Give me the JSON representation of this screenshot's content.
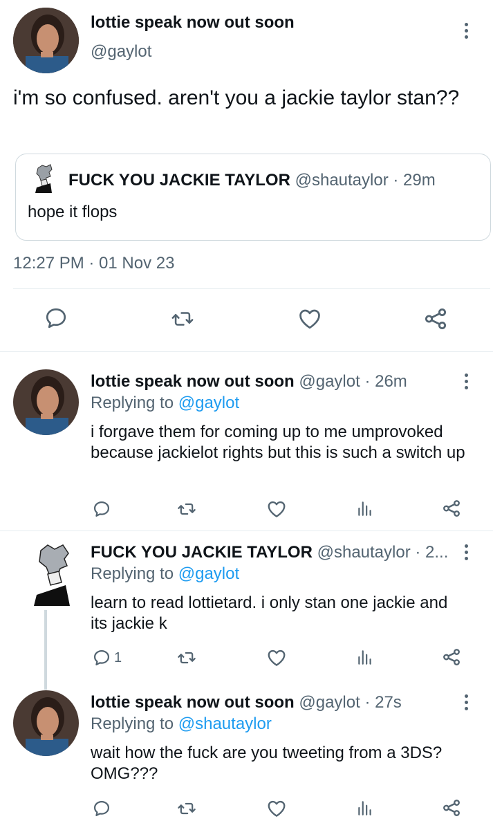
{
  "main_tweet": {
    "name": "lottie speak now out soon",
    "handle": "@gaylot",
    "text": "i'm so confused. aren't you a jackie taylor stan??",
    "timestamp": "12:27 PM · 01 Nov 23",
    "quoted": {
      "name": "FUCK YOU JACKIE TAYLOR",
      "handle": "@shautaylor",
      "time": "· 29m",
      "text": "hope it flops"
    }
  },
  "replies": [
    {
      "name": "lottie speak now out soon",
      "handle": "@gaylot",
      "time": "· 26m",
      "replying_label": "Replying to",
      "replying_to": "@gaylot",
      "text": "i forgave them for coming up to me umprovoked because jackielot rights but this is such a switch up",
      "reply_count": ""
    },
    {
      "name": "FUCK YOU JACKIE TAYLOR",
      "handle": "@shautaylor",
      "time": "· 2...",
      "replying_label": "Replying to",
      "replying_to": "@gaylot",
      "text": "learn to read lottietard. i only stan one jackie and its jackie k",
      "reply_count": "1"
    },
    {
      "name": "lottie speak now out soon",
      "handle": "@gaylot",
      "time": "· 27s",
      "replying_label": "Replying to",
      "replying_to": "@shautaylor",
      "text": "wait how the fuck are you tweeting from a 3DS? OMG???",
      "reply_count": ""
    }
  ],
  "icons": {
    "reply": "comment-bubble-icon",
    "retweet": "retweet-icon",
    "like": "heart-icon",
    "analytics": "bar-chart-icon",
    "share": "share-icon",
    "more": "more-options-icon"
  },
  "colors": {
    "text": "#0f1419",
    "secondary": "#536471",
    "link": "#1d9bf0",
    "divider": "#e6ecf0"
  }
}
